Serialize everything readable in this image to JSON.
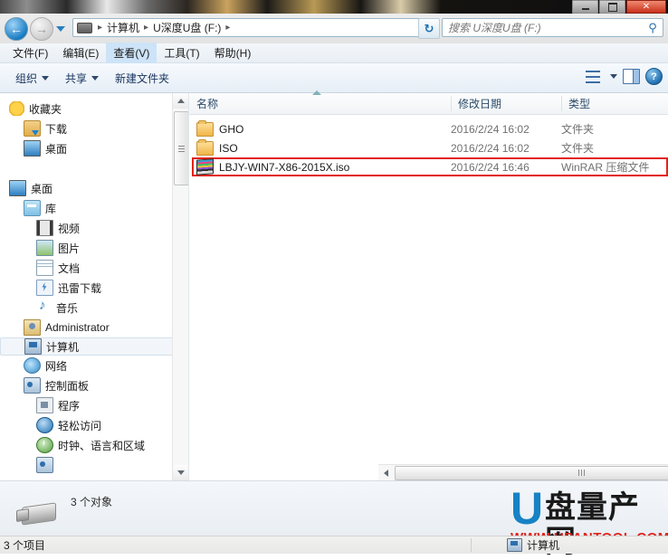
{
  "window": {
    "controls": {
      "minimize": "–",
      "maximize": "▭",
      "close": "✕"
    }
  },
  "addressbar": {
    "back_label": "←",
    "forward_label": "→",
    "crumbs": [
      "计算机",
      "U深度U盘 (F:)"
    ],
    "separator": "▸",
    "refresh_label": "↻"
  },
  "search": {
    "value": "",
    "placeholder": "搜索 U深度U盘 (F:)",
    "icon": "⚲"
  },
  "menubar": {
    "items": [
      {
        "label": "文件(F)",
        "active": false
      },
      {
        "label": "编辑(E)",
        "active": false
      },
      {
        "label": "查看(V)",
        "active": true
      },
      {
        "label": "工具(T)",
        "active": false
      },
      {
        "label": "帮助(H)",
        "active": false
      }
    ]
  },
  "toolbar": {
    "organize_label": "组织",
    "share_label": "共享",
    "newfolder_label": "新建文件夹",
    "help_label": "?"
  },
  "navpane": {
    "items": [
      {
        "label": "收藏夹",
        "icon": "star-icon",
        "level": 1
      },
      {
        "label": "下载",
        "icon": "downloads-icon",
        "level": 2
      },
      {
        "label": "桌面",
        "icon": "desktop-icon",
        "level": 2
      },
      {
        "label": "",
        "icon": "",
        "level": 1
      },
      {
        "label": "桌面",
        "icon": "desktop-icon",
        "level": 1
      },
      {
        "label": "库",
        "icon": "library-icon",
        "level": 2
      },
      {
        "label": "视频",
        "icon": "video-icon",
        "level": 3
      },
      {
        "label": "图片",
        "icon": "pictures-icon",
        "level": 3
      },
      {
        "label": "文档",
        "icon": "documents-icon",
        "level": 3
      },
      {
        "label": "迅雷下载",
        "icon": "thunder-download-icon",
        "level": 3
      },
      {
        "label": "音乐",
        "icon": "music-icon",
        "level": 3
      },
      {
        "label": "Administrator",
        "icon": "user-icon",
        "level": 2
      },
      {
        "label": "计算机",
        "icon": "computer-icon",
        "level": 2,
        "selected": true
      },
      {
        "label": "网络",
        "icon": "network-icon",
        "level": 2
      },
      {
        "label": "控制面板",
        "icon": "control-panel-icon",
        "level": 2
      },
      {
        "label": "程序",
        "icon": "programs-icon",
        "level": 3
      },
      {
        "label": "轻松访问",
        "icon": "ease-of-access-icon",
        "level": 3
      },
      {
        "label": "时钟、语言和区域",
        "icon": "clock-icon",
        "level": 3
      }
    ]
  },
  "filelist": {
    "columns": [
      {
        "label": "名称",
        "key": "name"
      },
      {
        "label": "修改日期",
        "key": "date"
      },
      {
        "label": "类型",
        "key": "type"
      }
    ],
    "sort_column": "名称",
    "rows": [
      {
        "name": "GHO",
        "date": "2016/2/24 16:02",
        "type": "文件夹",
        "icon": "folder-icon",
        "highlighted": false
      },
      {
        "name": "ISO",
        "date": "2016/2/24 16:02",
        "type": "文件夹",
        "icon": "folder-icon",
        "highlighted": false
      },
      {
        "name": "LBJY-WIN7-X86-2015X.iso",
        "date": "2016/2/24 16:46",
        "type": "WinRAR 压缩文件",
        "icon": "iso-archive-icon",
        "highlighted": true
      }
    ],
    "highlight_color": "#e2231a"
  },
  "details": {
    "object_count_label": "3 个对象",
    "drive_icon": "usb-drive-icon"
  },
  "watermark": {
    "logo_letter": "U",
    "logo_text": "盘量产网",
    "url_text": "WWW.UPANTOOL.COM",
    "logo_color": "#1782c4",
    "url_color": "#e0241b"
  },
  "statusbar": {
    "items_label": "3 个项目",
    "location_label": "计算机"
  }
}
